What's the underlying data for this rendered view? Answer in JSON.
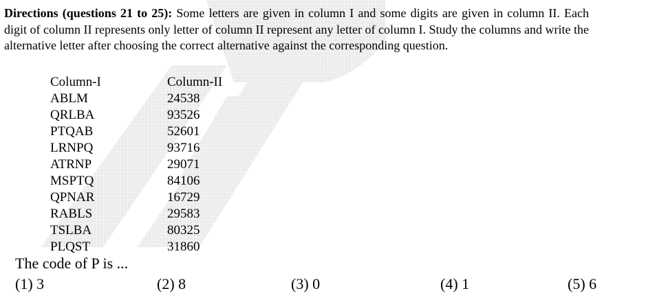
{
  "directions": {
    "lead": "Directions (questions 21 to 25):",
    "body": " Some letters are given in column I and some digits are given in column II. Each digit of column II represents only letter of column II represent any letter of column I. Study the columns and write the alternative letter after choosing the correct alternative against the corresponding question."
  },
  "table": {
    "headers": [
      "Column-I",
      "Column-II"
    ],
    "rows": [
      [
        "ABLM",
        "24538"
      ],
      [
        "QRLBA",
        "93526"
      ],
      [
        "PTQAB",
        "52601"
      ],
      [
        "LRNPQ",
        "93716"
      ],
      [
        "ATRNP",
        "29071"
      ],
      [
        "MSPTQ",
        "84106"
      ],
      [
        "QPNAR",
        "16729"
      ],
      [
        "RABLS",
        "29583"
      ],
      [
        "TSLBA",
        "80325"
      ],
      [
        "PLQST",
        "31860"
      ]
    ]
  },
  "question": {
    "text": "The code of P is ...",
    "options": [
      "(1) 3",
      "(2) 8",
      "(3) 0",
      "(4) 1",
      "(5) 6"
    ]
  },
  "watermark": {
    "color": "#e6e6e6"
  }
}
